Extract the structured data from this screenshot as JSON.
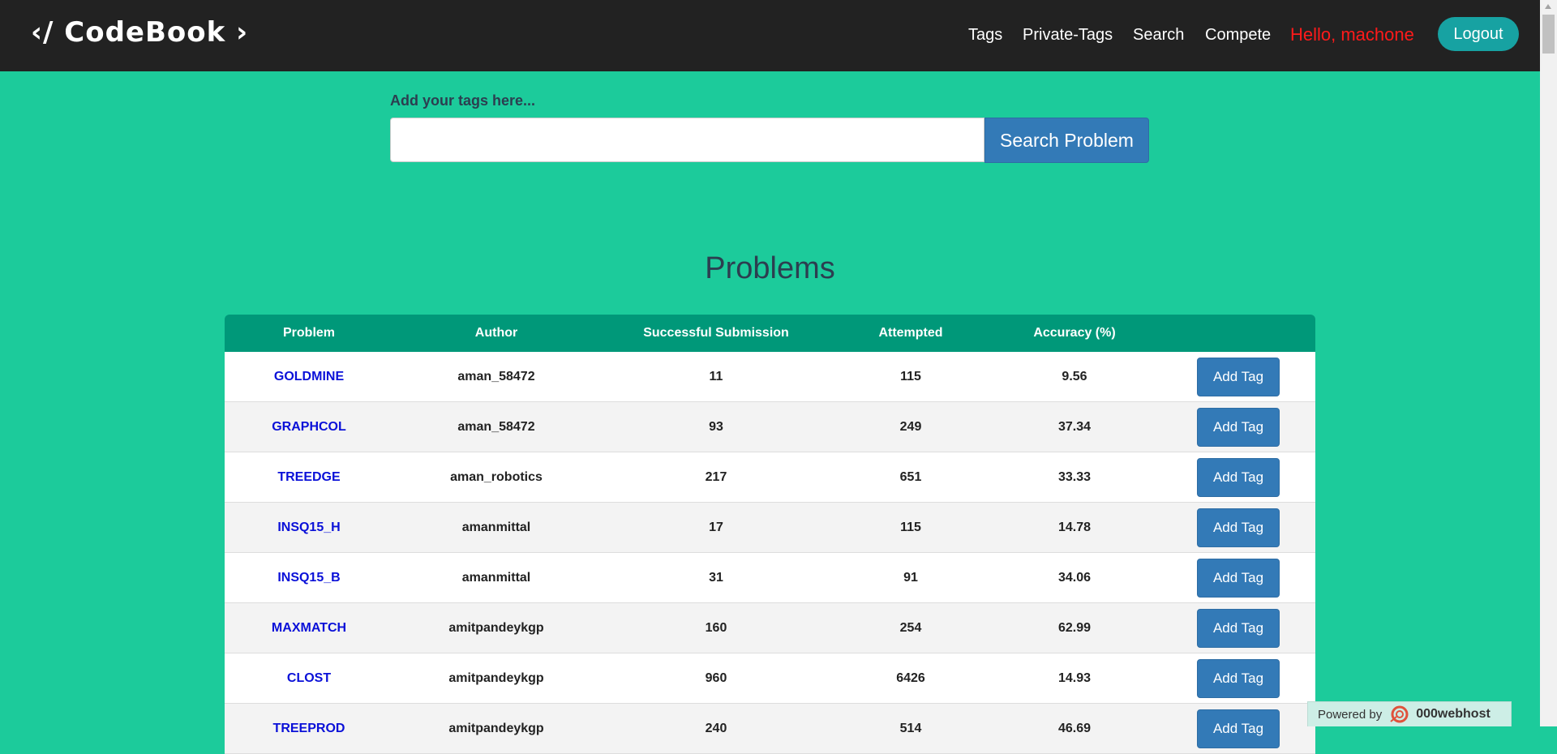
{
  "navbar": {
    "brand": "CodeBook",
    "brand_left": "‹/",
    "brand_right": "›",
    "links": [
      "Tags",
      "Private-Tags",
      "Search",
      "Compete"
    ],
    "greeting": "Hello, machone",
    "logout": "Logout"
  },
  "search": {
    "label": "Add your tags here...",
    "value": "",
    "button": "Search Problem"
  },
  "problems": {
    "heading": "Problems",
    "columns": [
      "Problem",
      "Author",
      "Successful Submission",
      "Attempted",
      "Accuracy (%)",
      ""
    ],
    "add_tag_label": "Add Tag",
    "rows": [
      {
        "problem": "GOLDMINE",
        "author": "aman_58472",
        "success": "11",
        "attempted": "115",
        "accuracy": "9.56"
      },
      {
        "problem": "GRAPHCOL",
        "author": "aman_58472",
        "success": "93",
        "attempted": "249",
        "accuracy": "37.34"
      },
      {
        "problem": "TREEDGE",
        "author": "aman_robotics",
        "success": "217",
        "attempted": "651",
        "accuracy": "33.33"
      },
      {
        "problem": "INSQ15_H",
        "author": "amanmittal",
        "success": "17",
        "attempted": "115",
        "accuracy": "14.78"
      },
      {
        "problem": "INSQ15_B",
        "author": "amanmittal",
        "success": "31",
        "attempted": "91",
        "accuracy": "34.06"
      },
      {
        "problem": "MAXMATCH",
        "author": "amitpandeykgp",
        "success": "160",
        "attempted": "254",
        "accuracy": "62.99"
      },
      {
        "problem": "CLOST",
        "author": "amitpandeykgp",
        "success": "960",
        "attempted": "6426",
        "accuracy": "14.93"
      },
      {
        "problem": "TREEPROD",
        "author": "amitpandeykgp",
        "success": "240",
        "attempted": "514",
        "accuracy": "46.69"
      }
    ]
  },
  "footer": {
    "powered_by": "Powered by",
    "host": "000webhost"
  }
}
